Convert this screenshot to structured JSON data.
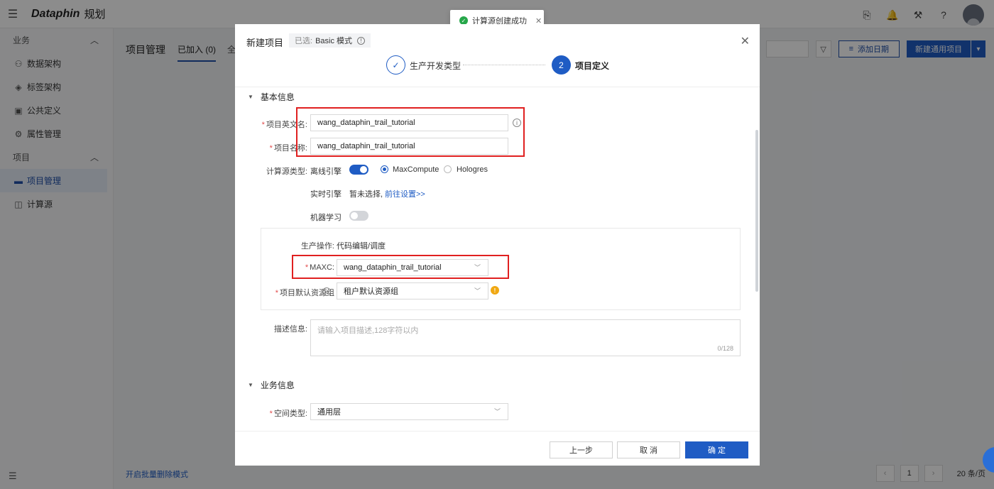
{
  "app": {
    "logo": "Dataphin",
    "module": "规划"
  },
  "sidebar": {
    "groups": [
      {
        "label": "业务",
        "items": [
          {
            "label": "数据架构",
            "icon": "tree-icon"
          },
          {
            "label": "标签架构",
            "icon": "layers-icon"
          },
          {
            "label": "公共定义",
            "icon": "doc-icon"
          },
          {
            "label": "属性管理",
            "icon": "settings-icon"
          }
        ]
      },
      {
        "label": "项目",
        "items": [
          {
            "label": "项目管理",
            "icon": "folder-icon",
            "active": true
          },
          {
            "label": "计算源",
            "icon": "compute-icon"
          }
        ]
      }
    ]
  },
  "main": {
    "title": "项目管理",
    "tab_joined": "已加入 (0)",
    "tab_all": "全",
    "add_date": "添加日期",
    "new_project": "新建通用项目",
    "batch_delete": "开启批量删除模式",
    "pager": {
      "current": "1",
      "page_size": "20 条/页"
    }
  },
  "toast": {
    "message": "计算源创建成功"
  },
  "modal": {
    "title": "新建项目",
    "mode_prefix": "已选:",
    "mode_value": "Basic 模式",
    "steps": [
      {
        "number": "",
        "label": "生产开发类型",
        "status": "done"
      },
      {
        "number": "2",
        "label": "项目定义",
        "status": "active"
      }
    ],
    "basic_section": "基本信息",
    "fields": {
      "en_name_label": "项目英文名:",
      "en_name_value": "wang_dataphin_trail_tutorial",
      "name_label": "项目名称:",
      "name_value": "wang_dataphin_trail_tutorial",
      "compute_type_label": "计算源类型:",
      "offline_engine": "离线引擎",
      "option_maxcompute": "MaxCompute",
      "option_hologres": "Hologres",
      "realtime_engine": "实时引擎",
      "realtime_none": "暂未选择,",
      "realtime_link": "前往设置>>",
      "ml_label": "机器学习",
      "prod_op_label": "生产操作:",
      "prod_op_value": "代码编辑/调度",
      "maxc_label": "MAXC:",
      "maxc_value": "wang_dataphin_trail_tutorial",
      "resource_group_label": "项目默认资源组",
      "resource_group_value": "租户默认资源组",
      "desc_label": "描述信息:",
      "desc_placeholder": "请输入项目描述,128字符以内",
      "desc_count": "0/128"
    },
    "business_section": "业务信息",
    "space_type_label": "空间类型:",
    "space_type_value": "通用层",
    "buttons": {
      "prev": "上一步",
      "cancel": "取 消",
      "confirm": "确 定"
    }
  }
}
